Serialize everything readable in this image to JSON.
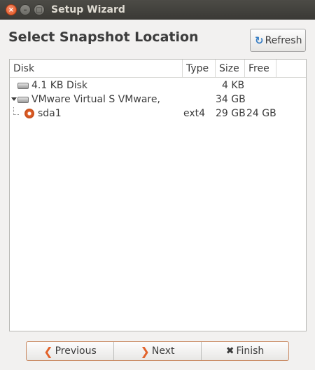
{
  "window": {
    "title": "Setup Wizard",
    "close_glyph": "×",
    "min_glyph": "–",
    "max_glyph": "□"
  },
  "heading": "Select Snapshot Location",
  "refresh": {
    "icon": "refresh-icon",
    "glyph": "↻",
    "label": "Refresh"
  },
  "columns": {
    "disk": "Disk",
    "type": "Type",
    "size": "Size",
    "free": "Free"
  },
  "rows": [
    {
      "disk": "4.1 KB Disk",
      "type": "",
      "size": "4 KB",
      "free": "",
      "icon": "hard-disk-icon"
    },
    {
      "disk": "VMware Virtual S VMware,",
      "type": "",
      "size": "34 GB",
      "free": "",
      "icon": "hard-disk-icon",
      "expanded": true
    },
    {
      "disk": "sda1",
      "type": "ext4",
      "size": "29 GB",
      "free": "24 GB",
      "icon": "partition-icon"
    }
  ],
  "nav": {
    "previous": {
      "glyph": "❮",
      "label": "Previous"
    },
    "next": {
      "glyph": "❯",
      "label": "Next"
    },
    "finish": {
      "glyph": "✖",
      "label": "Finish"
    }
  },
  "colors": {
    "accent": "#e2622a",
    "titlebar": "#3c3b37"
  }
}
